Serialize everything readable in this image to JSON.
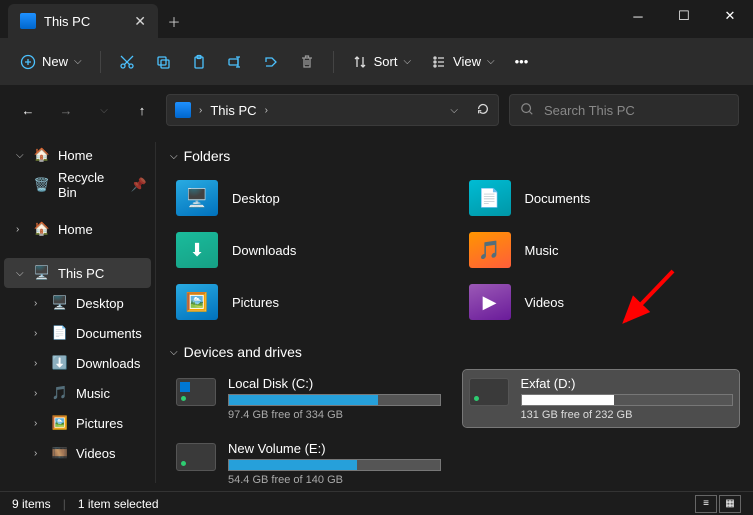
{
  "tab": {
    "title": "This PC"
  },
  "toolbar": {
    "new_label": "New",
    "sort_label": "Sort",
    "view_label": "View"
  },
  "nav": {
    "breadcrumb": "This PC",
    "search_placeholder": "Search This PC"
  },
  "sidebar": {
    "home": "Home",
    "recycle": "Recycle Bin",
    "home2": "Home",
    "thispc": "This PC",
    "desktop": "Desktop",
    "documents": "Documents",
    "downloads": "Downloads",
    "music": "Music",
    "pictures": "Pictures",
    "videos": "Videos"
  },
  "sections": {
    "folders": "Folders",
    "drives": "Devices and drives"
  },
  "folders": [
    {
      "label": "Desktop",
      "color": "c-blue"
    },
    {
      "label": "Documents",
      "color": "c-teal"
    },
    {
      "label": "Downloads",
      "color": "c-green"
    },
    {
      "label": "Music",
      "color": "c-orange"
    },
    {
      "label": "Pictures",
      "color": "c-blue"
    },
    {
      "label": "Videos",
      "color": "c-purple"
    }
  ],
  "drives": [
    {
      "label": "Local Disk (C:)",
      "sub": "97.4 GB free of 334 GB",
      "win": true,
      "pct": 71,
      "selected": false
    },
    {
      "label": "Exfat (D:)",
      "sub": "131 GB free of 232 GB",
      "win": false,
      "pct": 44,
      "selected": true
    },
    {
      "label": "New Volume (E:)",
      "sub": "54.4 GB free of 140 GB",
      "win": false,
      "pct": 61,
      "selected": false
    }
  ],
  "status": {
    "items": "9 items",
    "selected": "1 item selected"
  }
}
